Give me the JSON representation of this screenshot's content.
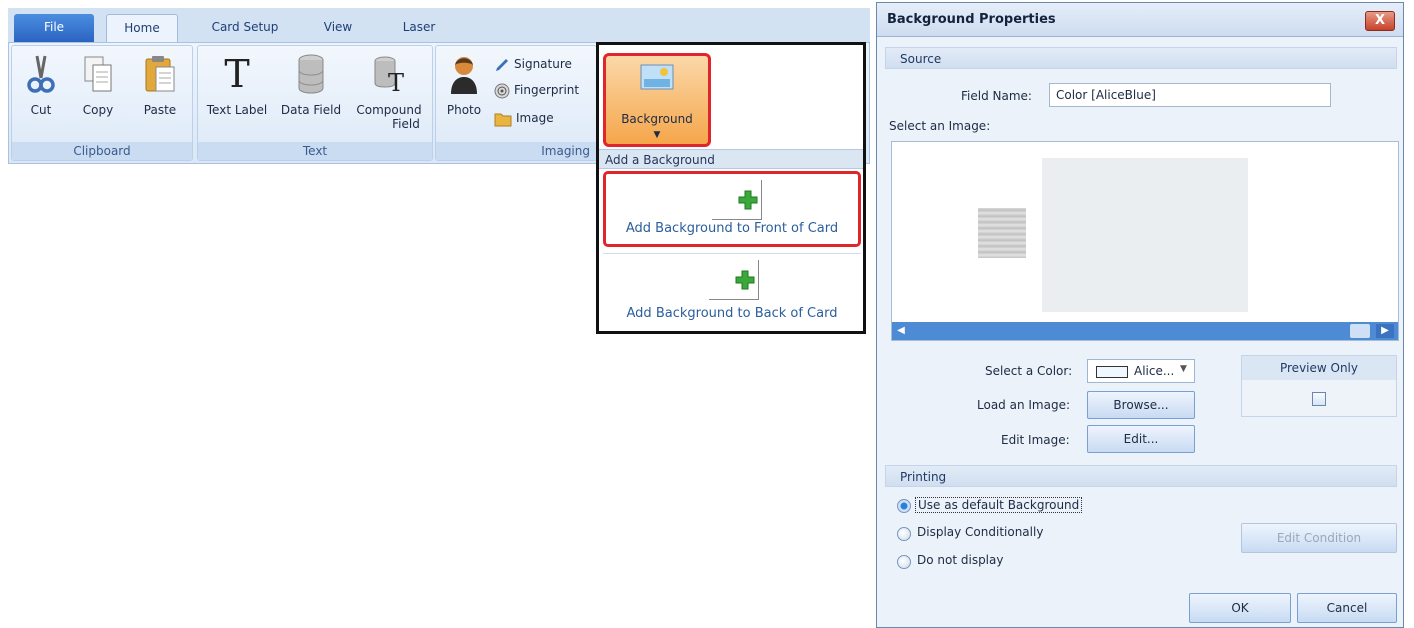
{
  "ribbon": {
    "tabs": [
      "File",
      "Home",
      "Card Setup",
      "View",
      "Laser"
    ],
    "clipboard": {
      "cut": "Cut",
      "copy": "Copy",
      "paste": "Paste",
      "group_label": "Clipboard"
    },
    "text": {
      "text_label": "Text Label",
      "data_field": "Data Field",
      "compound_line1": "Compound",
      "compound_line2": "Field",
      "group_label": "Text"
    },
    "imaging": {
      "photo": "Photo",
      "signature": "Signature",
      "fingerprint": "Fingerprint",
      "image": "Image",
      "group_label": "Imaging"
    }
  },
  "background_menu": {
    "button_label": "Background",
    "header": "Add a Background",
    "options": [
      "Add Background to Front of Card",
      "Add Background to Back of Card"
    ]
  },
  "dialog": {
    "title": "Background Properties",
    "close_label": "X",
    "source": {
      "header": "Source",
      "field_name_label": "Field Name:",
      "field_name_value": "Color [AliceBlue]",
      "select_image_label": "Select an Image:",
      "select_color_label": "Select a Color:",
      "color_value": "Alice...",
      "color_swatch": "#F0F8FF",
      "load_image_label": "Load an Image:",
      "browse_button": "Browse...",
      "edit_image_label": "Edit Image:",
      "edit_button": "Edit...",
      "preview_only_label": "Preview Only",
      "preview_only_checked": false
    },
    "printing": {
      "header": "Printing",
      "options": [
        "Use as default Background",
        "Display Conditionally",
        "Do not display"
      ],
      "selected": "Use as default Background",
      "edit_condition_button": "Edit Condition"
    },
    "ok_button": "OK",
    "cancel_button": "Cancel"
  },
  "colors": {
    "ribbon_blue": "#D3E2F3",
    "highlight_red": "#E0262B",
    "background_button_orange": "#F5A64A",
    "link_blue": "#2A5E9C",
    "scrollbar_blue": "#4D8CD4"
  }
}
